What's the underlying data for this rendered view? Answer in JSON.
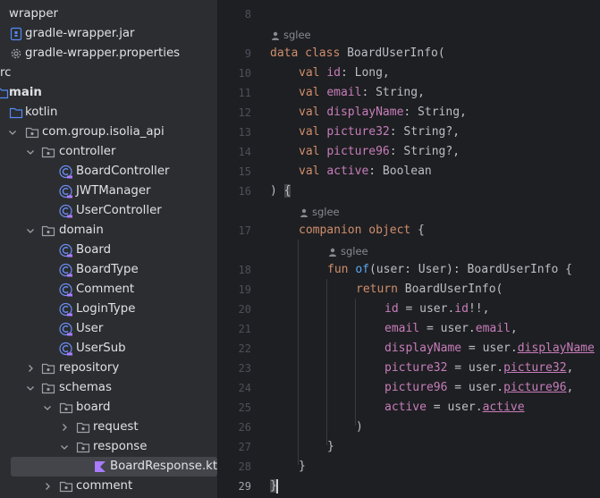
{
  "colors": {
    "tree_bg": "#2b2d30",
    "editor_bg": "#1e1f22",
    "selection": "#43454a",
    "keyword": "#cf8e6d",
    "property": "#c77dbb",
    "function": "#56a8f5",
    "text": "#bcbec4",
    "class_icon": "#6c8ef5",
    "kotlin_icon": "#a97bff"
  },
  "tree": [
    {
      "label": "wrapper",
      "icon": "folder-icon",
      "chevron": "none"
    },
    {
      "label": "gradle-wrapper.jar",
      "icon": "archive-icon",
      "chevron": "none"
    },
    {
      "label": "gradle-wrapper.properties",
      "icon": "gear-icon",
      "chevron": "none"
    },
    {
      "label": "rc",
      "icon": "none",
      "chevron": "none"
    },
    {
      "label": "main",
      "icon": "folder-icon",
      "chevron": "none",
      "bold": true
    },
    {
      "label": "kotlin",
      "icon": "source-folder-icon",
      "chevron": "none"
    },
    {
      "label": "com.group.isolia_api",
      "icon": "package-icon",
      "chevron": "down"
    },
    {
      "label": "controller",
      "icon": "package-icon",
      "chevron": "down"
    },
    {
      "label": "BoardController",
      "icon": "class-icon",
      "chevron": "none"
    },
    {
      "label": "JWTManager",
      "icon": "class-icon",
      "chevron": "none"
    },
    {
      "label": "UserController",
      "icon": "class-icon",
      "chevron": "none"
    },
    {
      "label": "domain",
      "icon": "package-icon",
      "chevron": "down"
    },
    {
      "label": "Board",
      "icon": "class-icon",
      "chevron": "none"
    },
    {
      "label": "BoardType",
      "icon": "class-icon",
      "chevron": "none"
    },
    {
      "label": "Comment",
      "icon": "class-icon",
      "chevron": "none"
    },
    {
      "label": "LoginType",
      "icon": "class-icon",
      "chevron": "none"
    },
    {
      "label": "User",
      "icon": "class-icon",
      "chevron": "none"
    },
    {
      "label": "UserSub",
      "icon": "class-icon",
      "chevron": "none"
    },
    {
      "label": "repository",
      "icon": "package-icon",
      "chevron": "right"
    },
    {
      "label": "schemas",
      "icon": "package-icon",
      "chevron": "down"
    },
    {
      "label": "board",
      "icon": "package-icon",
      "chevron": "down"
    },
    {
      "label": "request",
      "icon": "package-icon",
      "chevron": "right"
    },
    {
      "label": "response",
      "icon": "package-icon",
      "chevron": "down"
    },
    {
      "label": "BoardResponse.kt",
      "icon": "kotlin-file-icon",
      "chevron": "none",
      "selected": true
    },
    {
      "label": "comment",
      "icon": "package-icon",
      "chevron": "right"
    }
  ],
  "editor": {
    "line_numbers": [
      "8",
      "9",
      "10",
      "11",
      "12",
      "13",
      "14",
      "15",
      "16",
      "17",
      "18",
      "19",
      "20",
      "21",
      "22",
      "23",
      "24",
      "25",
      "26",
      "27",
      "28",
      "29"
    ],
    "current_line": "29",
    "author": "sglee",
    "code": {
      "l9_kw": "data class",
      "l9_rest": " BoardUserInfo(",
      "l10_kw": "val",
      "l10_prop": "id",
      "l10_rest": ": Long,",
      "l11_kw": "val",
      "l11_prop": "email",
      "l11_rest": ": String,",
      "l12_kw": "val",
      "l12_prop": "displayName",
      "l12_rest": ": String,",
      "l13_kw": "val",
      "l13_prop": "picture32",
      "l13_rest": ": String?,",
      "l14_kw": "val",
      "l14_prop": "picture96",
      "l14_rest": ": String?,",
      "l15_kw": "val",
      "l15_prop": "active",
      "l15_rest": ": Boolean",
      "l16_a": ") ",
      "l16_b": "{",
      "l17_kw": "companion object",
      "l17_rest": " {",
      "l18_kw": "fun",
      "l18_fn": "of",
      "l18_rest": "(user: User): BoardUserInfo {",
      "l19_kw": "return",
      "l19_rest": " BoardUserInfo(",
      "l20_p": "id",
      "l20_m": " = user.",
      "l20_q": "id",
      "l20_e": "!!,",
      "l21_p": "email",
      "l21_m": " = user.",
      "l21_q": "email",
      "l21_e": ",",
      "l22_p": "displayName",
      "l22_m": " = user.",
      "l22_q": "displayName",
      "l23_p": "picture32",
      "l23_m": " = user.",
      "l23_q": "picture32",
      "l23_e": ",",
      "l24_p": "picture96",
      "l24_m": " = user.",
      "l24_q": "picture96",
      "l24_e": ",",
      "l25_p": "active",
      "l25_m": " = user.",
      "l25_q": "active",
      "l26": ")",
      "l27": "}",
      "l28": "}",
      "l29": "}"
    }
  }
}
